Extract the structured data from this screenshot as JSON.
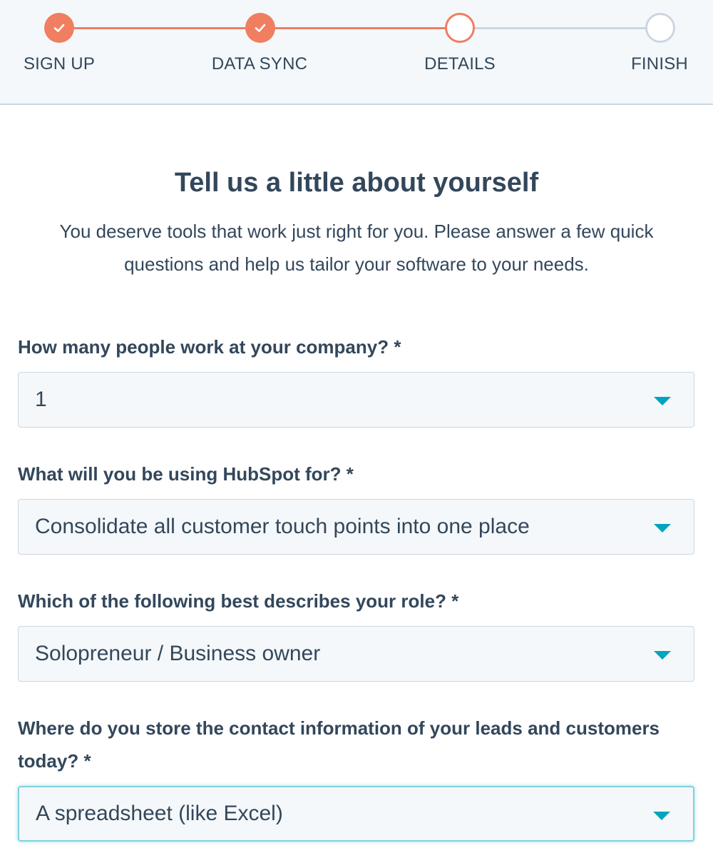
{
  "stepper": {
    "steps": [
      {
        "label": "SIGN UP",
        "state": "complete"
      },
      {
        "label": "DATA SYNC",
        "state": "complete"
      },
      {
        "label": "DETAILS",
        "state": "current"
      },
      {
        "label": "FINISH",
        "state": "upcoming"
      }
    ],
    "check_icon": "check-icon"
  },
  "header": {
    "title": "Tell us a little about yourself",
    "subtitle": "You deserve tools that work just right for you. Please answer a few quick questions and help us tailor your software to your needs."
  },
  "form": {
    "questions": [
      {
        "label": "How many people work at your company? *",
        "value": "1"
      },
      {
        "label": "What will you be using HubSpot for? *",
        "value": "Consolidate all customer touch points into one place"
      },
      {
        "label": "Which of the following best describes your role? *",
        "value": "Solopreneur / Business owner"
      },
      {
        "label": "Where do you store the contact information of your leads and customers today? *",
        "value": "A spreadsheet (like Excel)"
      }
    ]
  },
  "colors": {
    "accent_orange": "#f07e60",
    "caret_teal": "#00a4bd",
    "text": "#33475b",
    "border": "#cbd6e2",
    "field_bg": "#f5f8fa"
  }
}
